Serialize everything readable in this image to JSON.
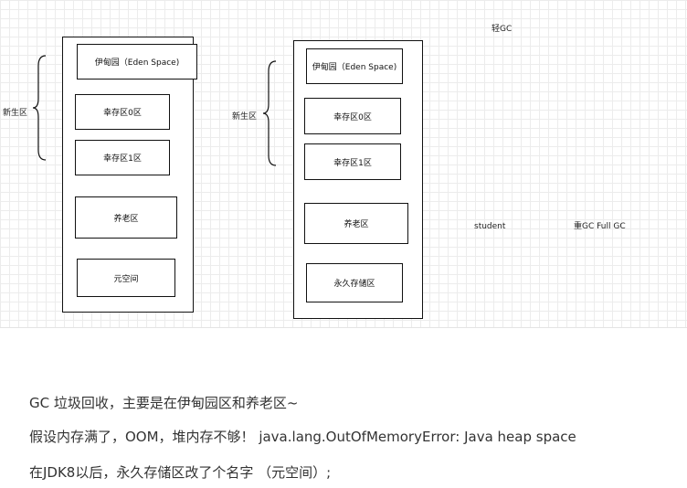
{
  "left_diagram": {
    "young_gen_label": "新生区",
    "eden": "伊甸园（Eden Space)",
    "survivor0": "幸存区0区",
    "survivor1": "幸存区1区",
    "old_gen": "养老区",
    "meta_space": "元空间"
  },
  "right_diagram": {
    "young_gen_label": "新生区",
    "eden": "伊甸园（Eden Space)",
    "survivor0": "幸存区0区",
    "survivor1": "幸存区1区",
    "old_gen": "养老区",
    "perm_gen": "永久存储区"
  },
  "annotations": {
    "light_gc": "轻GC",
    "student": "student",
    "heavy_gc": "重GC  Full GC"
  },
  "text": {
    "line1": "GC 垃圾回收，主要是在伊甸园区和养老区~",
    "line2": "假设内存满了，OOM，堆内存不够！ java.lang.OutOfMemoryError: Java heap space",
    "line3": "在JDK8以后，永久存储区改了个名字 （元空间）;"
  }
}
